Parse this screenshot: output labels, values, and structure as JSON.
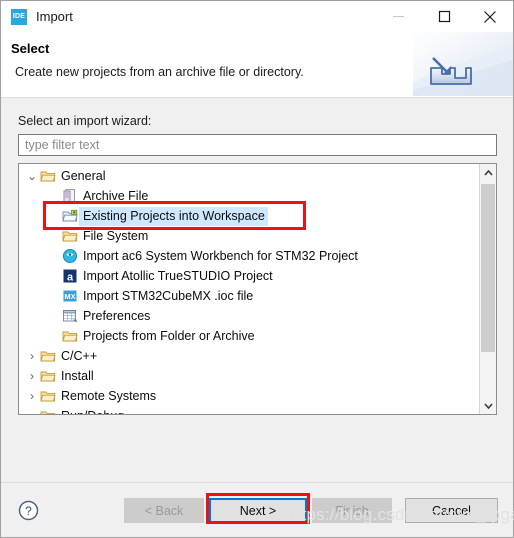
{
  "window": {
    "title": "Import",
    "app_icon_label": "IDE",
    "controls": {
      "minimize": "minimize-icon",
      "maximize": "maximize-icon",
      "close": "close-icon"
    }
  },
  "header": {
    "title": "Select",
    "description": "Create new projects from an archive file or directory.",
    "banner_icon": "import-tray-icon"
  },
  "body": {
    "wizard_label": "Select an import wizard:",
    "filter": {
      "value": "",
      "placeholder": "type filter text"
    },
    "tree": [
      {
        "label": "General",
        "level": 0,
        "icon": "folder-icon",
        "twisty": "expanded",
        "selected": false
      },
      {
        "label": "Archive File",
        "level": 1,
        "icon": "archive-file-icon",
        "twisty": "none",
        "selected": false
      },
      {
        "label": "Existing Projects into Workspace",
        "level": 1,
        "icon": "projects-import-folder-icon",
        "twisty": "none",
        "selected": true
      },
      {
        "label": "File System",
        "level": 1,
        "icon": "folder-icon",
        "twisty": "none",
        "selected": false
      },
      {
        "label": "Import ac6 System Workbench for STM32 Project",
        "level": 1,
        "icon": "ac6-circle-icon",
        "twisty": "none",
        "selected": false
      },
      {
        "label": "Import Atollic TrueSTUDIO Project",
        "level": 1,
        "icon": "atollic-a-icon",
        "twisty": "none",
        "selected": false
      },
      {
        "label": "Import STM32CubeMX .ioc file",
        "level": 1,
        "icon": "cubemx-icon",
        "twisty": "none",
        "selected": false
      },
      {
        "label": "Preferences",
        "level": 1,
        "icon": "preferences-icon",
        "twisty": "none",
        "selected": false
      },
      {
        "label": "Projects from Folder or Archive",
        "level": 1,
        "icon": "folder-icon",
        "twisty": "none",
        "selected": false
      },
      {
        "label": "C/C++",
        "level": 0,
        "icon": "folder-icon",
        "twisty": "collapsed",
        "selected": false
      },
      {
        "label": "Install",
        "level": 0,
        "icon": "folder-icon",
        "twisty": "collapsed",
        "selected": false
      },
      {
        "label": "Remote Systems",
        "level": 0,
        "icon": "folder-icon",
        "twisty": "collapsed",
        "selected": false
      },
      {
        "label": "Run/Debug",
        "level": 0,
        "icon": "folder-icon",
        "twisty": "collapsed",
        "selected": false
      }
    ],
    "scrollbar": {
      "up_arrow": "chevron-up-icon",
      "down_arrow": "chevron-down-icon"
    }
  },
  "footer": {
    "help_icon": "help-question-icon",
    "buttons": {
      "back": {
        "label": "< Back",
        "enabled": false
      },
      "next": {
        "label": "Next >",
        "enabled": true,
        "focused": true
      },
      "finish": {
        "label": "Finish",
        "enabled": false
      },
      "cancel": {
        "label": "Cancel",
        "enabled": true
      }
    }
  },
  "annotations": {
    "highlight_color": "#ee1111",
    "selection_color": "#cde8ff",
    "focus_color": "#0078d7",
    "watermark": "https://blog.csdn.net/stm_fpga"
  }
}
